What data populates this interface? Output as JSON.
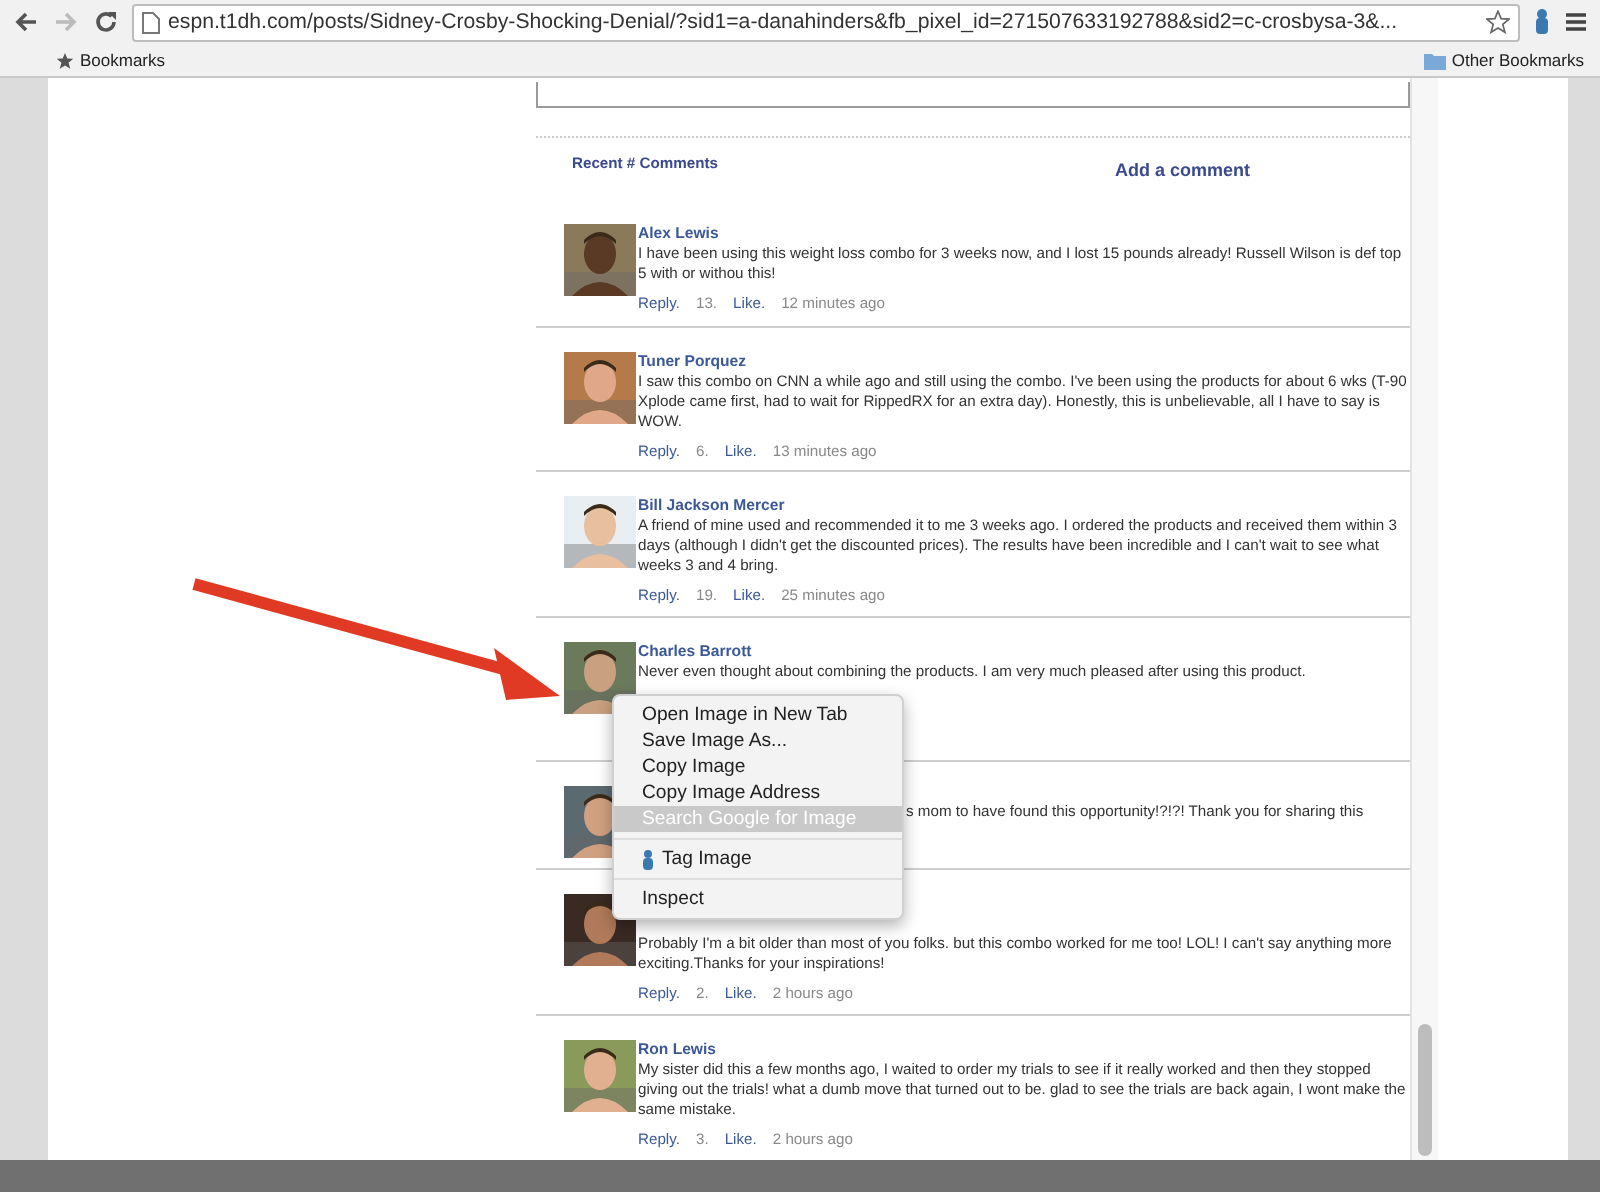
{
  "browser": {
    "url": "espn.t1dh.com/posts/Sidney-Crosby-Shocking-Denial/?sid1=a-danahinders&fb_pixel_id=271507633192788&sid2=c-crosbysa-3&...",
    "bookmarks": [
      {
        "label": "Bookmarks",
        "kind": "star"
      },
      {
        "label": "Other Bookmarks",
        "kind": "folder"
      }
    ]
  },
  "comments_header": {
    "title": "Recent # Comments",
    "add_link": "Add a comment"
  },
  "comments": [
    {
      "kind": "full",
      "author": "Alex Lewis",
      "text": "I have been using this weight loss combo for 3 weeks now, and I lost 15 pounds already! Russell Wilson is def top 5 with or withou this!",
      "reply": "Reply.",
      "likes": "13.",
      "like": "Like.",
      "time": "12 minutes ago"
    },
    {
      "kind": "full",
      "author": "Tuner Porquez",
      "text": "I saw this combo on CNN a while ago and still using the combo. I've been using the products for about 6 wks (T-90 Xplode came first, had to wait for RippedRX for an extra day). Honestly, this is unbelievable, all I have to say is WOW.",
      "reply": "Reply.",
      "likes": "6.",
      "like": "Like.",
      "time": "13 minutes ago"
    },
    {
      "kind": "full",
      "author": "Bill Jackson Mercer",
      "text": "A friend of mine used and recommended it to me 3 weeks ago. I ordered the products and received them within 3 days (although I didn't get the discounted prices). The results have been incredible and I can't wait to see what weeks 3 and 4 bring.",
      "reply": "Reply.",
      "likes": "19.",
      "like": "Like.",
      "time": "25 minutes ago"
    },
    {
      "kind": "footer_covered",
      "author": "Charles Barrott",
      "text": "Never even thought about combining the products. I am very much pleased after using this product."
    },
    {
      "kind": "mostly_covered",
      "text": "s mom to have found this opportunity!?!?! Thank you for sharing this"
    },
    {
      "kind": "name_covered",
      "text": "Probably I'm a bit older than most of you folks. but this combo worked for me too! LOL! I can't say anything more exciting.Thanks for your inspirations!",
      "reply": "Reply.",
      "likes": "2.",
      "like": "Like.",
      "time": "2 hours ago"
    },
    {
      "kind": "full",
      "author": "Ron Lewis",
      "text": "My sister did this a few months ago, I waited to order my trials to see if it really worked and then they stopped giving out the trials! what a dumb move that turned out to be. glad to see the trials are back again, I wont make the same mistake.",
      "reply": "Reply.",
      "likes": "3.",
      "like": "Like.",
      "time": "2 hours ago"
    }
  ],
  "context_menu": {
    "groups": [
      [
        {
          "label": "Open Image in New Tab",
          "selected": false
        },
        {
          "label": "Save Image As...",
          "selected": false
        },
        {
          "label": "Copy Image",
          "selected": false
        },
        {
          "label": "Copy Image Address",
          "selected": false
        },
        {
          "label": "Search Google for Image",
          "selected": true
        }
      ],
      [
        {
          "label": "Tag Image",
          "selected": false,
          "kind": "icon"
        }
      ],
      [
        {
          "label": "Inspect",
          "selected": false
        }
      ]
    ]
  }
}
